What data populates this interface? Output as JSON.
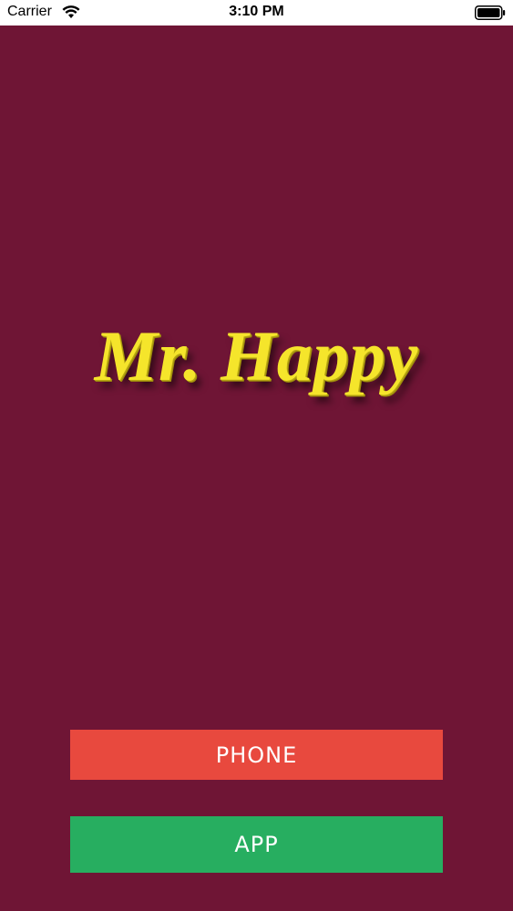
{
  "status_bar": {
    "carrier": "Carrier",
    "time": "3:10 PM",
    "wifi_icon": "wifi-icon",
    "battery_icon": "battery-icon"
  },
  "logo": {
    "text": "Mr. Happy",
    "color": "#f5e52b"
  },
  "background_color": "#6f1535",
  "buttons": {
    "phone": {
      "label": "PHONE",
      "color": "#e8493e"
    },
    "app": {
      "label": "APP",
      "color": "#27ae60"
    }
  }
}
